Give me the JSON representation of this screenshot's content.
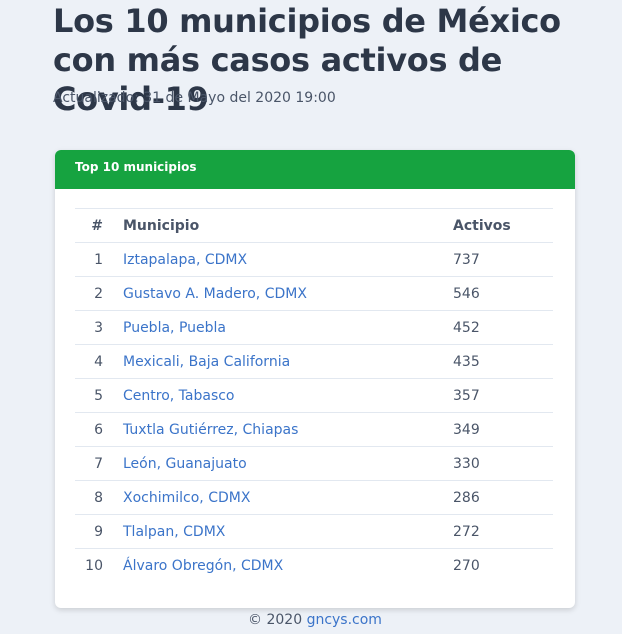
{
  "page": {
    "title": "Los 10 municipios de México con más casos activos de Covid-19",
    "updated": "Actualizado: 31 de Mayo del 2020 19:00"
  },
  "card": {
    "header": "Top 10 municipios",
    "columns": {
      "num": "#",
      "municipio": "Municipio",
      "activos": "Activos"
    },
    "rows": [
      {
        "num": "1",
        "municipio": "Iztapalapa, CDMX",
        "activos": "737"
      },
      {
        "num": "2",
        "municipio": "Gustavo A. Madero, CDMX",
        "activos": "546"
      },
      {
        "num": "3",
        "municipio": "Puebla, Puebla",
        "activos": "452"
      },
      {
        "num": "4",
        "municipio": "Mexicali, Baja California",
        "activos": "435"
      },
      {
        "num": "5",
        "municipio": "Centro, Tabasco",
        "activos": "357"
      },
      {
        "num": "6",
        "municipio": "Tuxtla Gutiérrez, Chiapas",
        "activos": "349"
      },
      {
        "num": "7",
        "municipio": "León, Guanajuato",
        "activos": "330"
      },
      {
        "num": "8",
        "municipio": "Xochimilco, CDMX",
        "activos": "286"
      },
      {
        "num": "9",
        "municipio": "Tlalpan, CDMX",
        "activos": "272"
      },
      {
        "num": "10",
        "municipio": "Álvaro Obregón, CDMX",
        "activos": "270"
      }
    ]
  },
  "footer": {
    "copyright": "© 2020 ",
    "link": "gncys.com"
  },
  "colors": {
    "background": "#edf1f7",
    "header_green": "#16a340",
    "link_blue": "#3b74c9"
  }
}
